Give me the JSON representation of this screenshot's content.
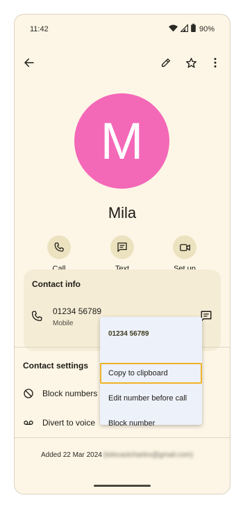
{
  "status_bar": {
    "time": "11:42",
    "battery": "90%"
  },
  "contact": {
    "initial": "M",
    "name": "Mila",
    "avatar_color": "#f468b8"
  },
  "actions": [
    {
      "label": "Call",
      "icon": "phone-icon"
    },
    {
      "label": "Text",
      "icon": "message-icon"
    },
    {
      "label": "Set up",
      "icon": "video-icon"
    }
  ],
  "contact_info": {
    "title": "Contact info",
    "phone_number": "01234 56789",
    "phone_type": "Mobile"
  },
  "context_menu": {
    "header": "01234 56789",
    "items": [
      {
        "label": "Copy to clipboard",
        "highlighted": true
      },
      {
        "label": "Edit number before call",
        "highlighted": false
      },
      {
        "label": "Block number",
        "highlighted": false
      }
    ],
    "highlight_color": "#f0b429"
  },
  "contact_settings": {
    "title": "Contact settings",
    "rows": [
      {
        "label": "Block numbers",
        "icon": "block-icon"
      },
      {
        "label": "Divert to voice",
        "icon": "voicemail-icon"
      }
    ]
  },
  "footer": {
    "added_text": "Added 22 Mar 2024",
    "email_redacted": "(telecastcharles@gmail.com)"
  },
  "colors": {
    "background": "#fdf6e6",
    "action_circle": "#ece2c0",
    "info_card": "#f5ecd6",
    "menu": "#edf1f9"
  }
}
